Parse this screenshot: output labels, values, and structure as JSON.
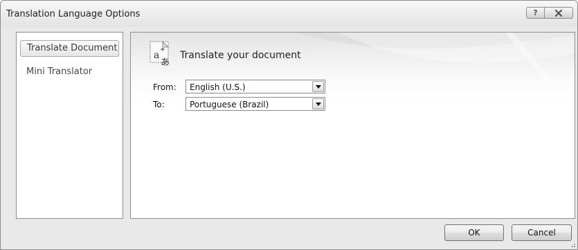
{
  "dialog": {
    "title": "Translation Language Options",
    "help_label": "?",
    "close_icon": "close-icon"
  },
  "sidebar": {
    "items": [
      {
        "label": "Translate Document",
        "selected": true
      },
      {
        "label": "Mini Translator",
        "selected": false
      }
    ]
  },
  "main": {
    "header_title": "Translate your document",
    "header_icon": "translate-document-icon",
    "from_label": "From:",
    "from_value": "English (U.S.)",
    "to_label": "To:",
    "to_value": "Portuguese (Brazil)"
  },
  "buttons": {
    "ok_label": "OK",
    "cancel_label": "Cancel"
  }
}
